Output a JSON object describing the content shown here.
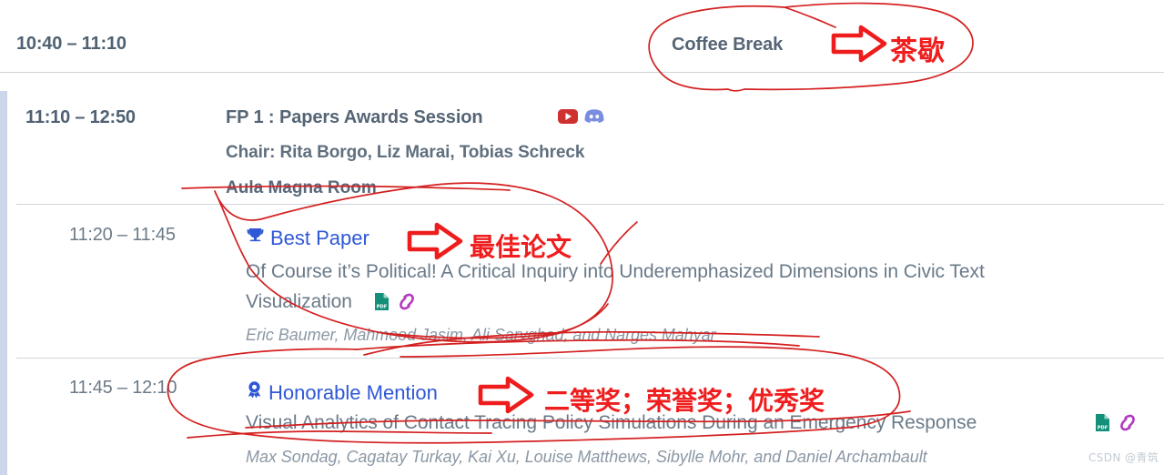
{
  "schedule": {
    "rows": [
      {
        "time": "10:40 – 11:10",
        "title": "Coffee Break"
      },
      {
        "time": "11:10 – 12:50",
        "title": "FP 1 : Papers Awards Session",
        "chair": "Chair: Rita Borgo, Liz Marai, Tobias Schreck",
        "room": "Aula Magna Room",
        "icons": [
          "youtube-icon",
          "discord-icon"
        ]
      }
    ],
    "papers": [
      {
        "time": "11:20 – 11:45",
        "award": "Best Paper",
        "award_icon": "trophy-icon",
        "title_line1": "Of Course it’s Political! A Critical Inquiry into Underemphasized Dimensions in Civic Text",
        "title_line2": "Visualization",
        "authors": "Eric Baumer, Mahmood Jasim, Ali Sarvghad, and Narges Mahyar",
        "icons": [
          "pdf-icon",
          "link-icon"
        ]
      },
      {
        "time": "11:45 – 12:10",
        "award": "Honorable Mention",
        "award_icon": "award-medal-icon",
        "title_line1": "Visual Analytics of Contact Tracing Policy Simulations During an Emergency Response",
        "title_line2": "",
        "authors": "Max Sondag, Cagatay Turkay, Kai Xu, Louise Matthews, Sibylle Mohr, and Daniel Archambault",
        "icons": [
          "pdf-icon",
          "link-icon"
        ]
      }
    ]
  },
  "annotations": {
    "coffee_break_cn": "茶歇",
    "best_paper_cn": "最佳论文",
    "honorable_mention_cn": "二等奖；荣誉奖；优秀奖",
    "ink_color": "#d42020",
    "arrow_color": "#ee1c1c",
    "text_color": "#ef1d1d"
  },
  "watermark": {
    "text": "CSDN @青筑"
  },
  "colors": {
    "time_text": "#4f6173",
    "session_text": "#556575",
    "award_blue": "#2f58d6",
    "paper_title": "#6a7a89",
    "authors": "#8b98a5",
    "left_bar": "#ccd6ea",
    "divider": "#cfd4d9",
    "youtube_red": "#cf3030",
    "discord_blue": "#7a8ce0",
    "pdf_teal": "#14907a",
    "link_purple": "#b23bbd"
  }
}
